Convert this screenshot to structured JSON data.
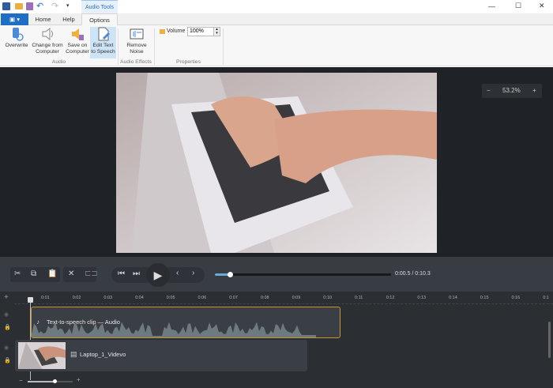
{
  "titlebar": {
    "context_tab": "Audio Tools",
    "minimize": "—",
    "maximize": "☐",
    "close": "✕"
  },
  "tabs": [
    {
      "label": "Home"
    },
    {
      "label": "Help"
    },
    {
      "label": "Options",
      "active": true
    }
  ],
  "ribbon": {
    "buttons": [
      {
        "label1": "Overwrite",
        "label2": ""
      },
      {
        "label1": "Change from",
        "label2": "Computer"
      },
      {
        "label1": "Save on",
        "label2": "Computer"
      },
      {
        "label1": "Edit Text",
        "label2": "to Speech"
      },
      {
        "label1": "Remove",
        "label2": "Noise"
      }
    ],
    "groups": {
      "audio": "Audio",
      "effects": "Audio Effects",
      "properties": "Properties"
    },
    "volume_label": "Volume",
    "volume_value": "100%"
  },
  "preview": {
    "zoom": "53.2%",
    "zoom_out": "−",
    "zoom_in": "+"
  },
  "playback": {
    "time": "0:00.5 / 0:10.3",
    "progress": 0.05
  },
  "timeline": {
    "ticks": [
      "0:01",
      "0:02",
      "0:03",
      "0:04",
      "0:05",
      "0:06",
      "0:07",
      "0:08",
      "0:09",
      "0:10",
      "0:11",
      "0:12",
      "0:13",
      "0:14",
      "0:15",
      "0:16",
      "0:1"
    ],
    "audio_clip": "Text-to-speech clip — Audio",
    "video_clip": "Laptop_1_Videvo",
    "zoom_level": 0.6
  },
  "colors": {
    "accent": "#1e6fc4",
    "selected": "#c9952e"
  }
}
